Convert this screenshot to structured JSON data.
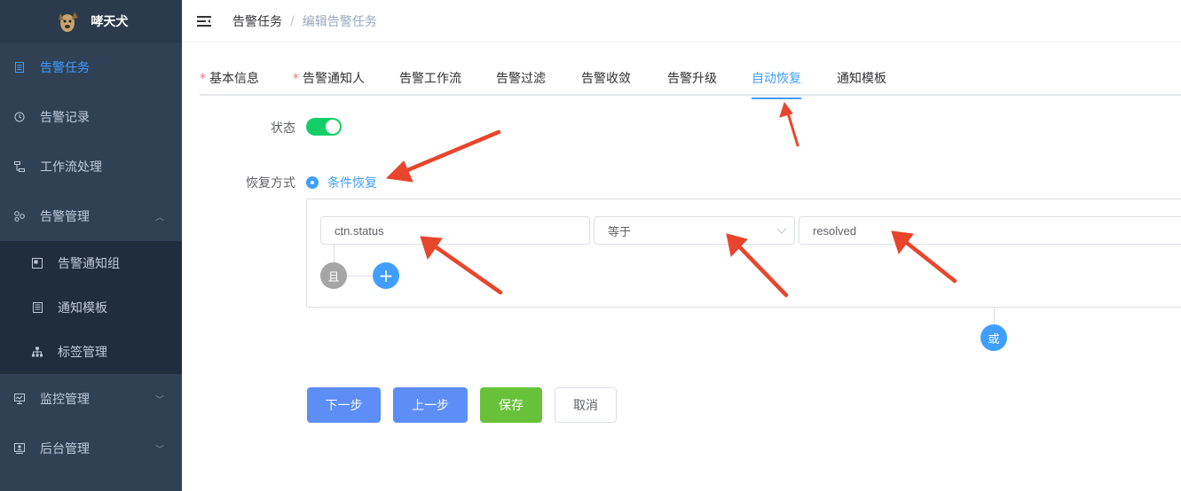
{
  "app": {
    "title": "哮天犬"
  },
  "sidebar": {
    "items": [
      {
        "label": "告警任务",
        "icon": "document-icon"
      },
      {
        "label": "告警记录",
        "icon": "clock-icon"
      },
      {
        "label": "工作流处理",
        "icon": "workflow-icon"
      },
      {
        "label": "告警管理",
        "icon": "cluster-icon"
      },
      {
        "label": "监控管理",
        "icon": "monitor-icon"
      },
      {
        "label": "后台管理",
        "icon": "admin-icon"
      }
    ],
    "sub_items": [
      {
        "label": "告警通知组",
        "icon": "group-icon"
      },
      {
        "label": "通知模板",
        "icon": "template-icon"
      },
      {
        "label": "标签管理",
        "icon": "tree-icon"
      }
    ]
  },
  "header": {
    "breadcrumb": [
      "告警任务",
      "编辑告警任务"
    ],
    "separator": "/"
  },
  "tabs": [
    {
      "label": "基本信息",
      "required": true
    },
    {
      "label": "告警通知人",
      "required": true
    },
    {
      "label": "告警工作流",
      "required": false
    },
    {
      "label": "告警过滤",
      "required": false
    },
    {
      "label": "告警收敛",
      "required": false
    },
    {
      "label": "告警升级",
      "required": false
    },
    {
      "label": "自动恢复",
      "required": false,
      "active": true
    },
    {
      "label": "通知模板",
      "required": false
    }
  ],
  "required_mark": "*",
  "form": {
    "status_label": "状态",
    "status_on": true,
    "recovery_label": "恢复方式",
    "recovery_option": "条件恢复",
    "condition": {
      "field": "ctn.status",
      "operator": "等于",
      "value": "resolved"
    },
    "and_label": "且",
    "add_label": "+",
    "or_label": "或"
  },
  "buttons": {
    "next": "下一步",
    "prev": "上一步",
    "save": "保存",
    "cancel": "取消"
  },
  "colors": {
    "sidebar_bg": "#304156",
    "accent": "#409eff",
    "success": "#67c23a",
    "annotation": "#e8452c"
  }
}
